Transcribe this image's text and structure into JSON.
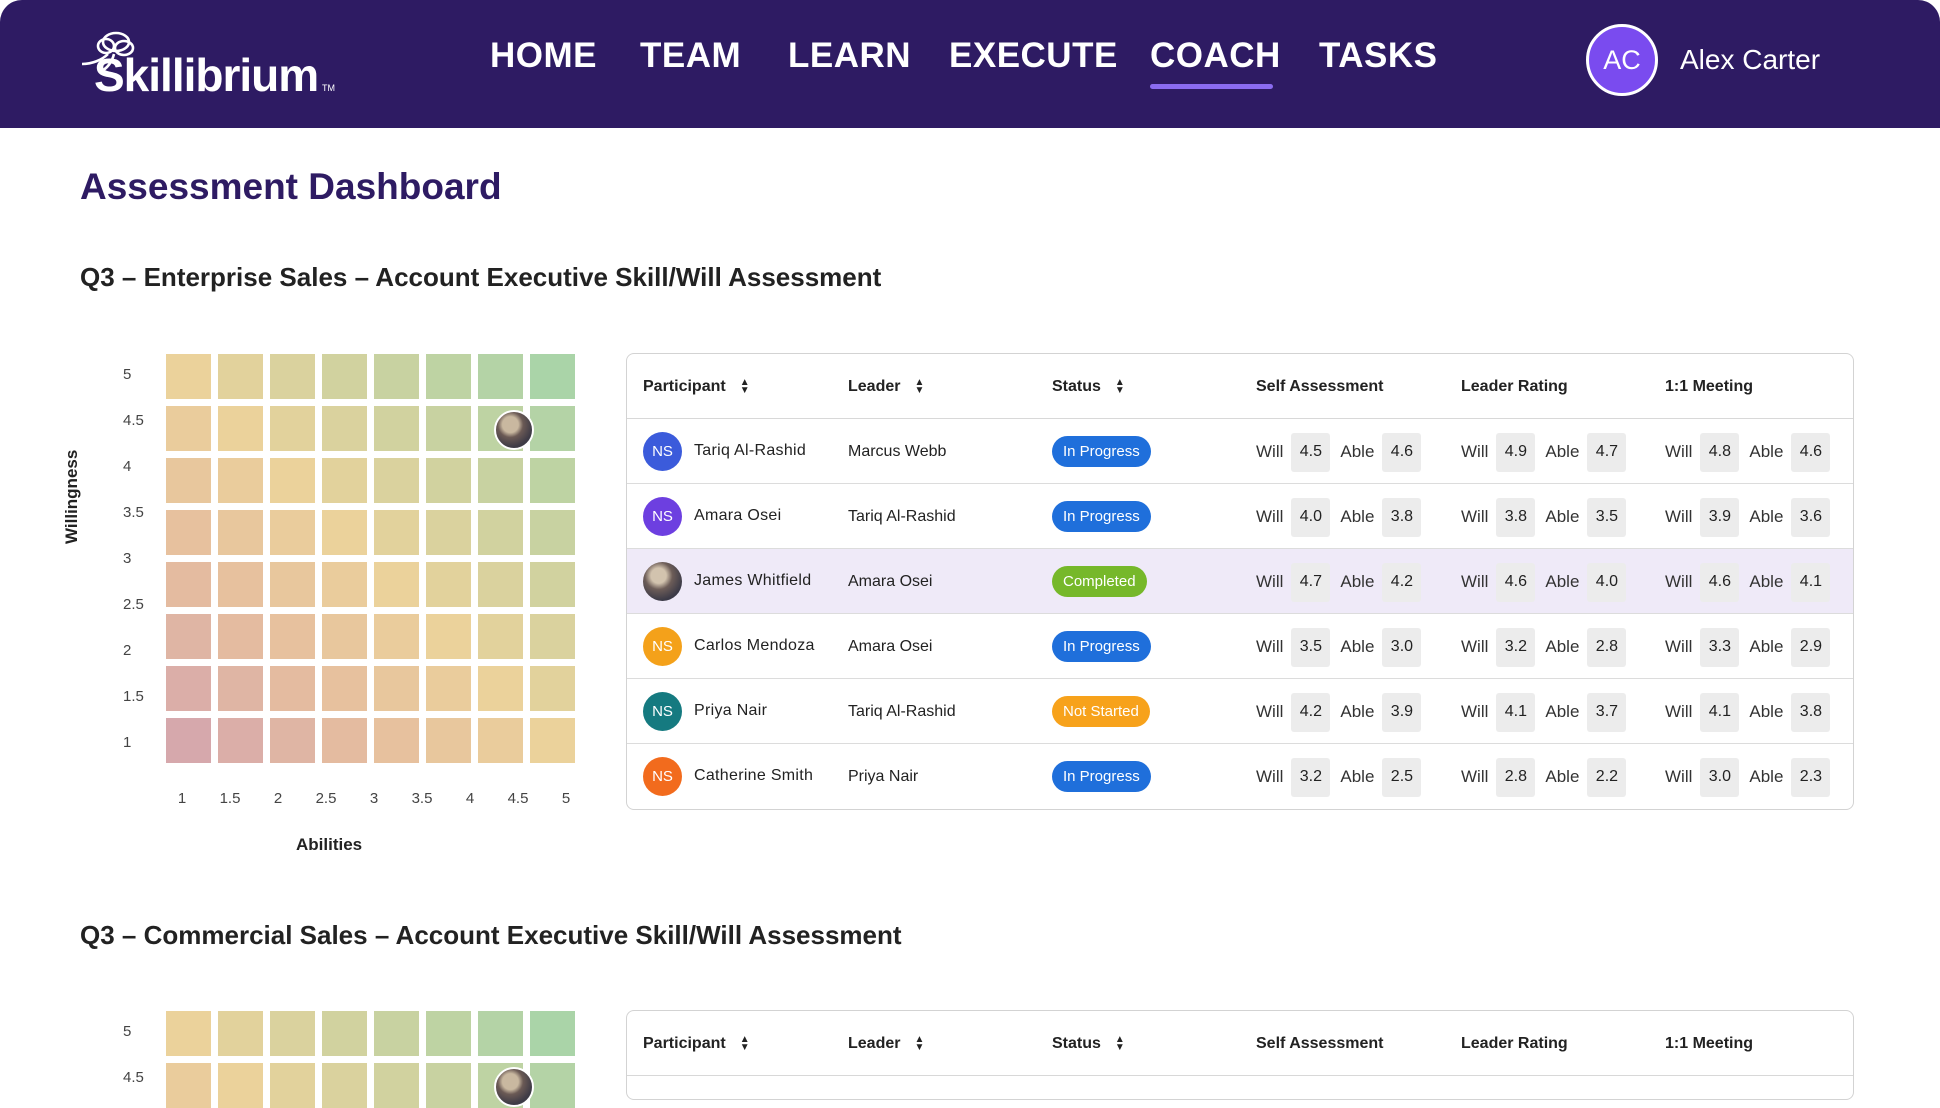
{
  "app": {
    "name": "Skillibrium",
    "tm": "TM"
  },
  "nav": {
    "items": [
      {
        "label": "HOME"
      },
      {
        "label": "TEAM"
      },
      {
        "label": "LEARN"
      },
      {
        "label": "EXECUTE"
      },
      {
        "label": "COACH"
      },
      {
        "label": "TASKS"
      }
    ],
    "active": "COACH"
  },
  "user": {
    "initials": "AC",
    "name": "Alex Carter"
  },
  "page": {
    "title": "Assessment Dashboard"
  },
  "colors": {
    "header_bg": "#2e1b63",
    "accent": "#8b6cf0",
    "in_progress": "#1f6fdb",
    "completed": "#76b82a",
    "not_started": "#f7a21b"
  },
  "matrix": {
    "xlabel": "Abilities",
    "ylabel": "Willingness",
    "ticks": [
      "1",
      "1.5",
      "2",
      "2.5",
      "3",
      "3.5",
      "4",
      "4.5",
      "5"
    ],
    "ticks_y": [
      "5",
      "4.5",
      "4",
      "3.5",
      "3",
      "2.5",
      "2",
      "1.5",
      "1"
    ]
  },
  "sections": [
    {
      "title": "Q3 – Enterprise Sales – Account Executive Skill/Will Assessment",
      "marker": {
        "able": 4.5,
        "will": 4.5
      },
      "table": {
        "headers": {
          "participant": "Participant",
          "leader": "Leader",
          "status": "Status",
          "self": "Self Assessment",
          "leader_rating": "Leader Rating",
          "meeting": "1:1 Meeting"
        },
        "will_label": "Will",
        "able_label": "Able",
        "rows": [
          {
            "initials": "NS",
            "avatar_color": "#3b5bdb",
            "name": "Tariq Al-Rashid",
            "leader": "Marcus Webb",
            "status": "In Progress",
            "status_color": "#1f6fdb",
            "self": [
              "4.5",
              "4.6"
            ],
            "leader_rating": [
              "4.9",
              "4.7"
            ],
            "meeting": [
              "4.8",
              "4.6"
            ]
          },
          {
            "initials": "NS",
            "avatar_color": "#6d3fe0",
            "name": "Amara Osei",
            "leader": "Tariq Al-Rashid",
            "status": "In Progress",
            "status_color": "#1f6fdb",
            "self": [
              "4.0",
              "3.8"
            ],
            "leader_rating": [
              "3.8",
              "3.5"
            ],
            "meeting": [
              "3.9",
              "3.6"
            ]
          },
          {
            "initials": "",
            "avatar_color": "photo",
            "name": "James Whitfield",
            "leader": "Amara Osei",
            "status": "Completed",
            "status_color": "#76b82a",
            "self": [
              "4.7",
              "4.2"
            ],
            "leader_rating": [
              "4.6",
              "4.0"
            ],
            "meeting": [
              "4.6",
              "4.1"
            ],
            "highlight": true
          },
          {
            "initials": "NS",
            "avatar_color": "#f4a11a",
            "name": "Carlos Mendoza",
            "leader": "Amara Osei",
            "status": "In Progress",
            "status_color": "#1f6fdb",
            "self": [
              "3.5",
              "3.0"
            ],
            "leader_rating": [
              "3.2",
              "2.8"
            ],
            "meeting": [
              "3.3",
              "2.9"
            ]
          },
          {
            "initials": "NS",
            "avatar_color": "#157a80",
            "name": "Priya Nair",
            "leader": "Tariq Al-Rashid",
            "status": "Not Started",
            "status_color": "#f7a21b",
            "self": [
              "4.2",
              "3.9"
            ],
            "leader_rating": [
              "4.1",
              "3.7"
            ],
            "meeting": [
              "4.1",
              "3.8"
            ]
          },
          {
            "initials": "NS",
            "avatar_color": "#f26b1d",
            "name": "Catherine Smith",
            "leader": "Priya Nair",
            "status": "In Progress",
            "status_color": "#1f6fdb",
            "self": [
              "3.2",
              "2.5"
            ],
            "leader_rating": [
              "2.8",
              "2.2"
            ],
            "meeting": [
              "3.0",
              "2.3"
            ]
          }
        ]
      }
    },
    {
      "title": "Q3 – Commercial Sales – Account Executive Skill/Will Assessment",
      "marker": {
        "able": 4.5,
        "will": 4.5
      },
      "table": {
        "headers": {
          "participant": "Participant",
          "leader": "Leader",
          "status": "Status",
          "self": "Self Assessment",
          "leader_rating": "Leader Rating",
          "meeting": "1:1 Meeting"
        },
        "rows": []
      }
    }
  ]
}
